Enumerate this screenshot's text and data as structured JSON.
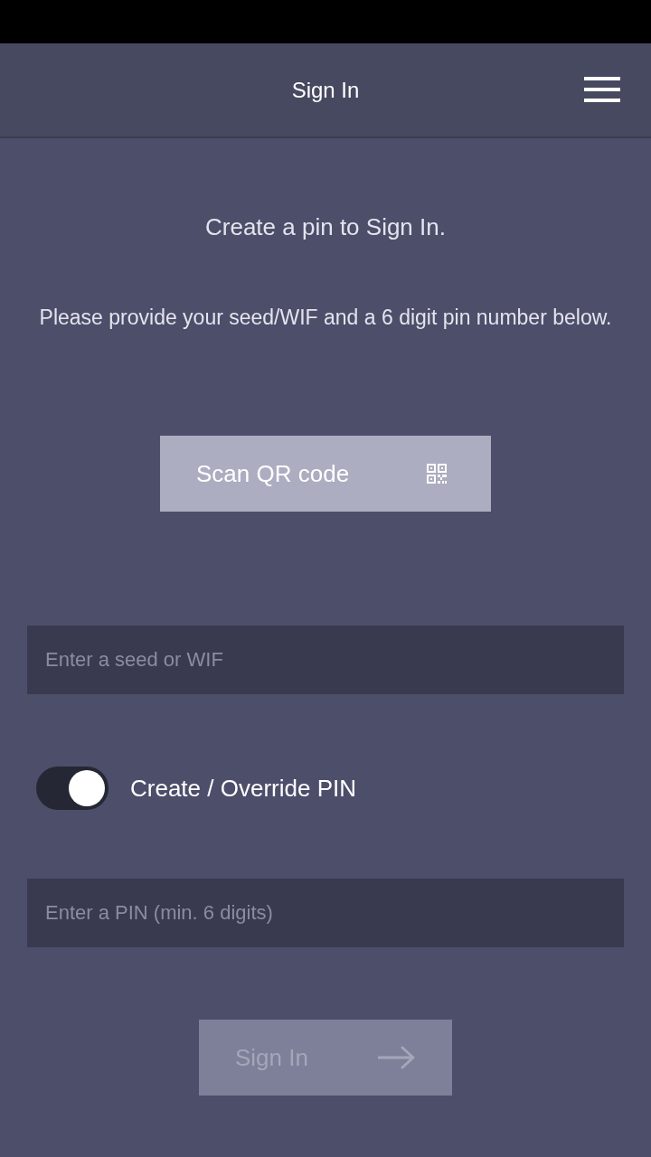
{
  "header": {
    "title": "Sign In"
  },
  "intro": {
    "heading": "Create a pin to Sign In.",
    "instructions": "Please provide your seed/WIF and a 6 digit pin number below."
  },
  "scan_button": {
    "label": "Scan QR code"
  },
  "seed_field": {
    "placeholder": "Enter a seed or WIF"
  },
  "pin_toggle": {
    "label": "Create / Override PIN",
    "on": true
  },
  "pin_field": {
    "placeholder": "Enter a PIN (min. 6 digits)"
  },
  "submit_button": {
    "label": "Sign In",
    "disabled": true
  }
}
